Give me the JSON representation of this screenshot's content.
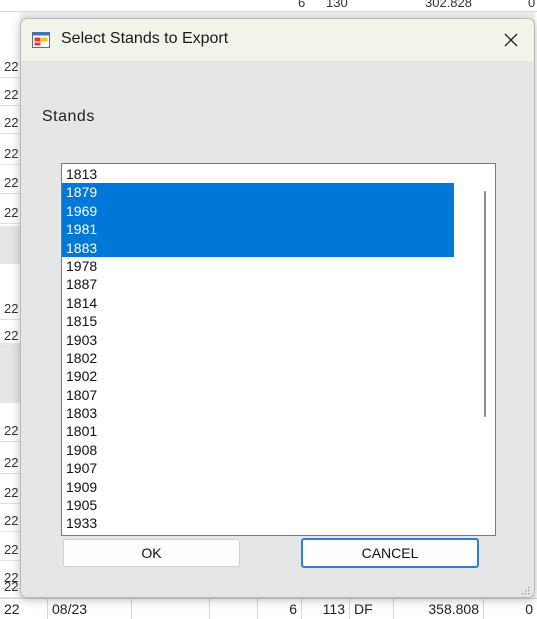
{
  "background": {
    "top_row": {
      "col_a": "6",
      "col_b": "130",
      "col_c": "302.828",
      "col_d": "0"
    },
    "left_col_values": [
      "22",
      "22",
      "22",
      "22",
      "22",
      "22",
      "22",
      "22",
      "22",
      "22",
      "22",
      "22",
      "22",
      "22",
      "22"
    ],
    "bottom_row": {
      "index": "22",
      "date": "08/23",
      "qty": "6",
      "num": "113",
      "species": "DF",
      "volume": "358.808",
      "last": "0"
    }
  },
  "dialog": {
    "title": "Select Stands to Export",
    "close_glyph": "✕",
    "stands_label": "Stands",
    "stands": [
      {
        "label": "1813",
        "selected": false
      },
      {
        "label": "1879",
        "selected": true
      },
      {
        "label": "1969",
        "selected": true
      },
      {
        "label": "1981",
        "selected": true
      },
      {
        "label": "1883",
        "selected": true
      },
      {
        "label": "1978",
        "selected": false
      },
      {
        "label": "1887",
        "selected": false
      },
      {
        "label": "1814",
        "selected": false
      },
      {
        "label": "1815",
        "selected": false
      },
      {
        "label": "1903",
        "selected": false
      },
      {
        "label": "1802",
        "selected": false
      },
      {
        "label": "1902",
        "selected": false
      },
      {
        "label": "1807",
        "selected": false
      },
      {
        "label": "1803",
        "selected": false
      },
      {
        "label": "1801",
        "selected": false
      },
      {
        "label": "1908",
        "selected": false
      },
      {
        "label": "1907",
        "selected": false
      },
      {
        "label": "1909",
        "selected": false
      },
      {
        "label": "1905",
        "selected": false
      },
      {
        "label": "1933",
        "selected": false
      }
    ],
    "ok_label": "OK",
    "cancel_label": "CANCEL",
    "colors": {
      "selection": "#0078d7",
      "titlebar": "#f1f4e8",
      "cancel_border": "#2f7fd6"
    },
    "icons": {
      "app": "form-app-icon",
      "close": "close-icon",
      "grip": "resize-grip-icon"
    }
  }
}
